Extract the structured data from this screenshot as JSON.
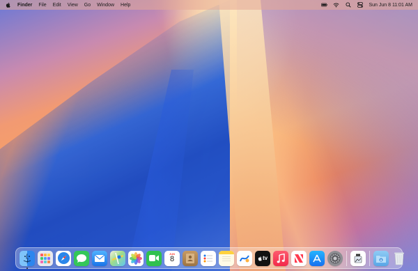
{
  "menubar": {
    "app_name": "Finder",
    "menus": [
      "File",
      "Edit",
      "View",
      "Go",
      "Window",
      "Help"
    ],
    "clock": "Sun Jun 8  11:01 AM"
  },
  "dock": {
    "apps": [
      {
        "name": "Finder",
        "icon": "finder-icon",
        "color": "#3b8cf0"
      },
      {
        "name": "Launchpad",
        "icon": "launchpad-icon",
        "color": "#e8e8ef"
      },
      {
        "name": "Safari",
        "icon": "safari-icon",
        "color": "#2a86ea"
      },
      {
        "name": "Messages",
        "icon": "messages-icon",
        "color": "#34c759"
      },
      {
        "name": "Mail",
        "icon": "mail-icon",
        "color": "#2c8ef4"
      },
      {
        "name": "Maps",
        "icon": "maps-icon",
        "color": "#64c86a"
      },
      {
        "name": "Photos",
        "icon": "photos-icon",
        "color": "#ffffff"
      },
      {
        "name": "FaceTime",
        "icon": "facetime-icon",
        "color": "#30c14e"
      },
      {
        "name": "Calendar",
        "icon": "calendar-icon",
        "color": "#ffffff",
        "month": "JUN",
        "day": "8"
      },
      {
        "name": "Contacts",
        "icon": "contacts-icon",
        "color": "#b58a55"
      },
      {
        "name": "Reminders",
        "icon": "reminders-icon",
        "color": "#ffffff"
      },
      {
        "name": "Notes",
        "icon": "notes-icon",
        "color": "#fff8d8"
      },
      {
        "name": "Freeform",
        "icon": "freeform-icon",
        "color": "#ffffff"
      },
      {
        "name": "TV",
        "icon": "tv-icon",
        "color": "#111111",
        "label": "tv"
      },
      {
        "name": "Music",
        "icon": "music-icon",
        "color": "#fa3a55"
      },
      {
        "name": "News",
        "icon": "news-icon",
        "color": "#ffffff"
      },
      {
        "name": "App Store",
        "icon": "app-store-icon",
        "color": "#1e8cf5"
      },
      {
        "name": "System Settings",
        "icon": "gear-icon",
        "color": "#8e8e93"
      }
    ],
    "extra": [
      {
        "name": "Preview",
        "icon": "preview-icon",
        "color": "#ffffff"
      }
    ],
    "trash_area": [
      {
        "name": "Downloads",
        "icon": "downloads-folder-icon",
        "color": "#6fb8ee"
      },
      {
        "name": "Trash",
        "icon": "trash-icon",
        "color": "#dfe3e8"
      }
    ]
  }
}
